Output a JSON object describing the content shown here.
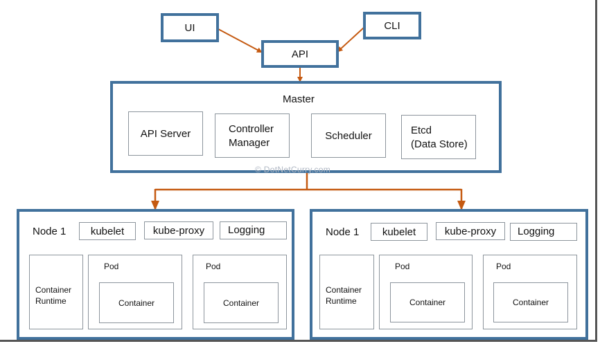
{
  "top": {
    "ui_label": "UI",
    "cli_label": "CLI",
    "api_label": "API"
  },
  "master": {
    "title": "Master",
    "components": [
      "API Server",
      "Controller Manager",
      "Scheduler",
      "Etcd (Data Store)"
    ],
    "controller_line1": "Controller",
    "controller_line2": "Manager",
    "etcd_line1": "Etcd",
    "etcd_line2": "(Data Store)"
  },
  "watermark": "© DotNetCurry.com",
  "nodes": [
    {
      "title": "Node 1",
      "kubelet": "kubelet",
      "kube_proxy": "kube-proxy",
      "logging": "Logging",
      "runtime_line1": "Container",
      "runtime_line2": "Runtime",
      "pods": [
        {
          "label": "Pod",
          "container": "Container"
        },
        {
          "label": "Pod",
          "container": "Container"
        }
      ]
    },
    {
      "title": "Node 1",
      "kubelet": "kubelet",
      "kube_proxy": "kube-proxy",
      "logging": "Logging",
      "runtime_line1": "Container",
      "runtime_line2": "Runtime",
      "pods": [
        {
          "label": "Pod",
          "container": "Container"
        },
        {
          "label": "Pod",
          "container": "Container"
        }
      ]
    }
  ],
  "colors": {
    "box_border": "#41719c",
    "arrow": "#c55a11",
    "thin_border": "#8c949c"
  }
}
